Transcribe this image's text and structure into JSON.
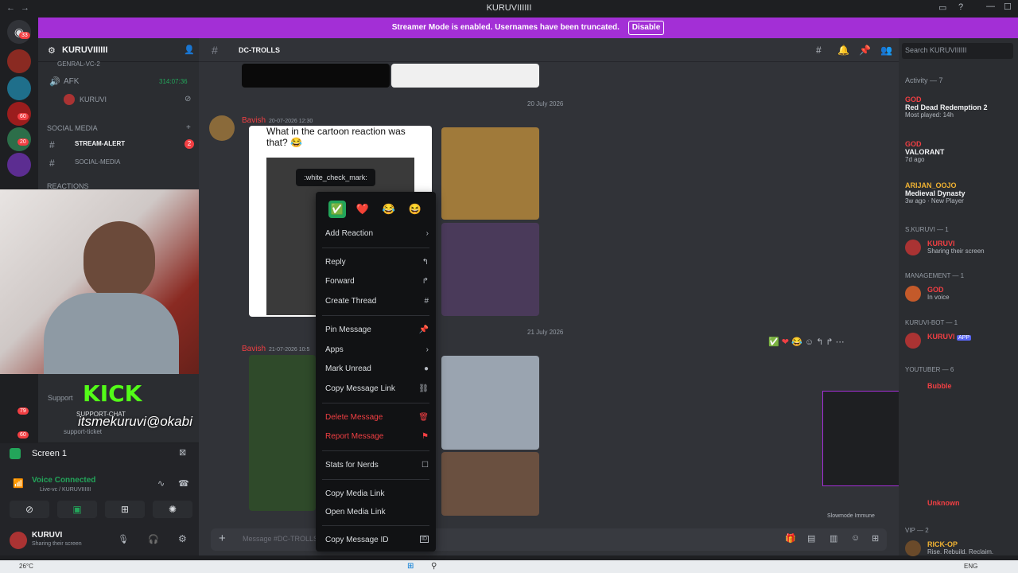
{
  "window": {
    "title": "KURUVIIIIII"
  },
  "banner": {
    "text": "Streamer Mode is enabled. Usernames have been truncated.",
    "button": "Disable"
  },
  "servers": {
    "badges": [
      "33",
      "60",
      "20",
      "79",
      "60"
    ]
  },
  "channels": {
    "server_name": "KURUVIIIIII",
    "general_partial": "GENRAL-VC-2",
    "afk": {
      "name": "AFK",
      "timer": "314:07:36"
    },
    "afk_user": "KURUVI",
    "social_category": "SOCIAL MEDIA",
    "stream_alert": "STREAM-ALERT",
    "stream_alert_badge": "2",
    "social_media": "SOCIAL-MEDIA",
    "reactions_category": "REACTIONS",
    "support": "Support",
    "support_chat": "SUPPORT-CHAT",
    "support_ticket": "support-ticket",
    "kick": "KICK",
    "handle": "itsmekuruvi@okabi"
  },
  "screenshare": {
    "label": "Screen 1"
  },
  "voice": {
    "status": "Voice Connected",
    "channel": "Live-vc / KURUVIIIIII"
  },
  "user": {
    "name": "KURUVI",
    "status": "Sharing their screen"
  },
  "main": {
    "channel": "DC-TROLLS",
    "dates": [
      "20 July 2026",
      "21 July 2026"
    ],
    "messages": [
      {
        "author": "Bavish",
        "time": "20-07-2026 12:30",
        "text": "What in the cartoon reaction was that? 😂"
      },
      {
        "author": "Bavish",
        "time": "21-07-2026 10:5"
      }
    ],
    "composer_placeholder": "Message #DC-TROLLS",
    "slowmode": "Slowmode Immune"
  },
  "context_menu": {
    "tooltip": ":white_check_mark:",
    "quick_reactions": [
      "✅",
      "❤️",
      "😂",
      "😆"
    ],
    "items": [
      {
        "label": "Add Reaction",
        "icon": "chevron-right-icon",
        "glyph": "›"
      },
      {
        "label": "Reply",
        "icon": "reply-icon",
        "glyph": "↰"
      },
      {
        "label": "Forward",
        "icon": "forward-icon",
        "glyph": "↱"
      },
      {
        "label": "Create Thread",
        "icon": "thread-icon",
        "glyph": "#"
      },
      {
        "label": "Pin Message",
        "icon": "pin-icon",
        "glyph": "📌"
      },
      {
        "label": "Apps",
        "icon": "chevron-right-icon",
        "glyph": "›"
      },
      {
        "label": "Mark Unread",
        "icon": "unread-icon",
        "glyph": "●"
      },
      {
        "label": "Copy Message Link",
        "icon": "link-icon",
        "glyph": "⛓"
      },
      {
        "label": "Delete Message",
        "icon": "trash-icon",
        "glyph": "🗑",
        "danger": true
      },
      {
        "label": "Report Message",
        "icon": "flag-icon",
        "glyph": "⚑",
        "danger": true
      },
      {
        "label": "Stats for Nerds",
        "icon": "checkbox-icon",
        "glyph": "☐"
      },
      {
        "label": "Copy Media Link",
        "icon": "",
        "glyph": ""
      },
      {
        "label": "Open Media Link",
        "icon": "",
        "glyph": ""
      },
      {
        "label": "Copy Message ID",
        "icon": "id-icon",
        "glyph": "ID"
      }
    ]
  },
  "members": {
    "search_placeholder": "Search KURUVIIIIII",
    "activity_header": "Activity — 7",
    "activity": [
      {
        "name": "GOD",
        "game": "Red Dead Redemption 2",
        "detail": "Most played: 14h"
      },
      {
        "name": "GOD",
        "game": "VALORANT",
        "detail": "7d ago"
      },
      {
        "name": "ARIJAN_OOJO",
        "game": "Medieval Dynasty",
        "detail": "3w ago · New Player"
      }
    ],
    "groups": [
      {
        "header": "S.KURUVI — 1",
        "name": "KURUVI",
        "status": "Sharing their screen"
      },
      {
        "header": "MANAGEMENT — 1",
        "name": "GOD",
        "status": "In voice"
      },
      {
        "header": "KURUVI-BOT — 1",
        "name": "KURUVI",
        "status": "",
        "badge": "APP"
      },
      {
        "header": "YOUTUBER — 6",
        "name": "Bubble",
        "status": ""
      },
      {
        "header": "",
        "name": "Unknown",
        "status": ""
      },
      {
        "header": "VIP — 2",
        "name": "RICK-OP",
        "status": "Rise. Rebuild. Reclaim."
      }
    ]
  },
  "taskbar": {
    "weather": "26°C",
    "lang": "ENG"
  },
  "colors": {
    "accent": "#a32fd6",
    "danger": "#f23f43",
    "green": "#23a55a",
    "bg": "#313338"
  }
}
